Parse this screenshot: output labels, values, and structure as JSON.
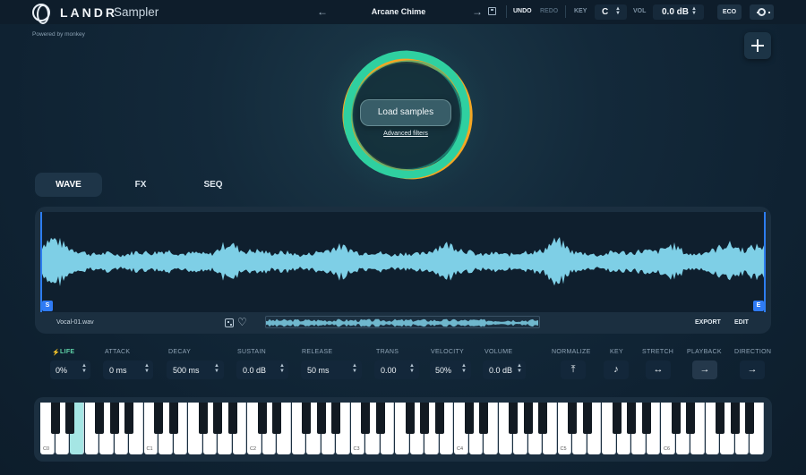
{
  "header": {
    "brand": "LANDR",
    "product": "Sampler",
    "powered_by": "Powered by monkey",
    "preset_name": "Arcane Chime",
    "undo": "UNDO",
    "redo": "REDO",
    "key_label": "KEY",
    "key_value": "C",
    "vol_label": "VOL",
    "vol_value": "0.0 dB",
    "eco": "ECO"
  },
  "center": {
    "load_button": "Load samples",
    "advanced_filters": "Advanced filters"
  },
  "tabs": [
    {
      "label": "WAVE",
      "active": true
    },
    {
      "label": "FX",
      "active": false
    },
    {
      "label": "SEQ",
      "active": false
    }
  ],
  "waveform": {
    "start_marker": "S",
    "end_marker": "E",
    "file_name": "Vocal-01.wav",
    "export": "EXPORT",
    "edit": "EDIT",
    "color": "#7ecfe6"
  },
  "params": {
    "life": {
      "label": "LIFE",
      "value": "0%"
    },
    "attack": {
      "label": "ATTACK",
      "value": "0 ms"
    },
    "decay": {
      "label": "DECAY",
      "value": "500 ms"
    },
    "sustain": {
      "label": "SUSTAIN",
      "value": "0.0 dB"
    },
    "release": {
      "label": "RELEASE",
      "value": "50 ms"
    },
    "trans": {
      "label": "TRANS",
      "value": "0.00"
    },
    "velocity": {
      "label": "VELOCITY",
      "value": "50%"
    },
    "volume": {
      "label": "VOLUME",
      "value": "0.0 dB"
    },
    "normalize": {
      "label": "NORMALIZE",
      "icon": "arrow-up-bar-icon"
    },
    "key": {
      "label": "KEY",
      "icon": "music-note-icon"
    },
    "stretch": {
      "label": "STRETCH",
      "icon": "stretch-arrows-icon"
    },
    "playback": {
      "label": "PLAYBACK",
      "icon": "arrow-right-icon"
    },
    "direction": {
      "label": "DIRECTION",
      "icon": "arrow-right-icon"
    }
  },
  "keyboard": {
    "octave_labels": [
      "C0",
      "C1",
      "C2",
      "C3",
      "C4",
      "C5",
      "C6"
    ],
    "pressed_key": "E0",
    "accent": "#a5e6e4"
  },
  "colors": {
    "accent_green": "#39d39a",
    "accent_orange": "#f5a623",
    "marker_blue": "#2f7bf5",
    "life_icon": "#5fd3a8"
  }
}
